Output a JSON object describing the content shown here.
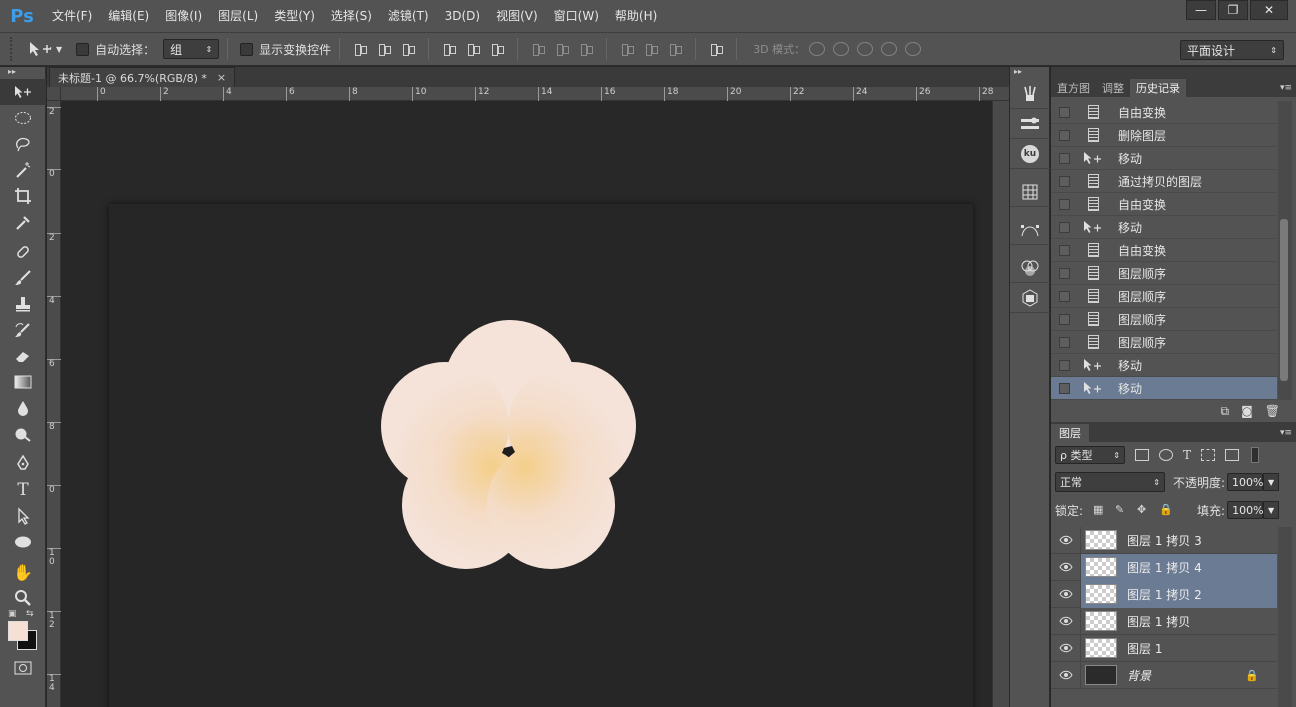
{
  "app": {
    "logo": "Ps"
  },
  "menu": [
    "文件(F)",
    "编辑(E)",
    "图像(I)",
    "图层(L)",
    "类型(Y)",
    "选择(S)",
    "滤镜(T)",
    "3D(D)",
    "视图(V)",
    "窗口(W)",
    "帮助(H)"
  ],
  "window_controls": {
    "minimize": "—",
    "restore": "❐",
    "close": "✕"
  },
  "options": {
    "tool_icon": "move-tool-icon",
    "auto_select_label": "自动选择：",
    "auto_select_value": "组",
    "show_transform_label": "显示变换控件",
    "mode3d_label": "3D 模式：",
    "workspace": "平面设计"
  },
  "document": {
    "tab_title": "未标题-1 @ 66.7%(RGB/8) *",
    "tab_close": "×",
    "ruler_h": [
      "0",
      "2",
      "4",
      "6",
      "8",
      "10",
      "12",
      "14",
      "16",
      "18",
      "20",
      "22",
      "24",
      "26",
      "28"
    ],
    "ruler_v": [
      "2",
      "0",
      "2",
      "4",
      "6",
      "8",
      "0",
      "1\n0",
      "1\n2",
      "1\n4",
      "1\n6"
    ]
  },
  "colors": {
    "foreground": "#f6e0d6",
    "background": "#111111",
    "petal": "#f5e3da",
    "petal_center": "#f4cf8a",
    "selection": "#6b7b93"
  },
  "history_panel": {
    "tabs": [
      "直方图",
      "调整",
      "历史记录"
    ],
    "active_tab": "历史记录",
    "items": [
      {
        "icon": "document-icon",
        "label": "自由变换",
        "selected": false
      },
      {
        "icon": "document-icon",
        "label": "删除图层",
        "selected": false
      },
      {
        "icon": "move-icon",
        "label": "移动",
        "selected": false
      },
      {
        "icon": "document-icon",
        "label": "通过拷贝的图层",
        "selected": false
      },
      {
        "icon": "document-icon",
        "label": "自由变换",
        "selected": false
      },
      {
        "icon": "move-icon",
        "label": "移动",
        "selected": false
      },
      {
        "icon": "document-icon",
        "label": "自由变换",
        "selected": false
      },
      {
        "icon": "document-icon",
        "label": "图层顺序",
        "selected": false
      },
      {
        "icon": "document-icon",
        "label": "图层顺序",
        "selected": false
      },
      {
        "icon": "document-icon",
        "label": "图层顺序",
        "selected": false
      },
      {
        "icon": "document-icon",
        "label": "图层顺序",
        "selected": false
      },
      {
        "icon": "move-icon",
        "label": "移动",
        "selected": false
      },
      {
        "icon": "move-icon",
        "label": "移动",
        "selected": true
      }
    ]
  },
  "layers_panel": {
    "tab": "图层",
    "filter_label": "ρ 类型",
    "blend_mode": "正常",
    "opacity_label": "不透明度:",
    "opacity_value": "100%",
    "lock_label": "锁定:",
    "fill_label": "填充:",
    "fill_value": "100%",
    "layers": [
      {
        "name": "图层 1 拷贝 3",
        "selected": false,
        "thumb": "transparent"
      },
      {
        "name": "图层 1 拷贝 4",
        "selected": true,
        "thumb": "transparent"
      },
      {
        "name": "图层 1 拷贝 2",
        "selected": true,
        "thumb": "transparent"
      },
      {
        "name": "图层 1 拷贝",
        "selected": false,
        "thumb": "transparent"
      },
      {
        "name": "图层 1",
        "selected": false,
        "thumb": "transparent"
      },
      {
        "name": "背景",
        "selected": false,
        "thumb": "dark",
        "locked": true
      }
    ]
  },
  "mid_panel": {
    "ku_label": "ku"
  }
}
